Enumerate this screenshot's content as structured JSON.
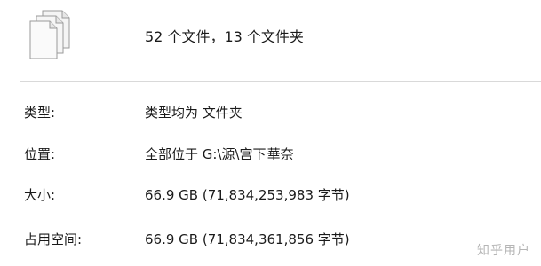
{
  "header": {
    "icon": "multiple-files-icon",
    "summary": "52 个文件，13 个文件夹"
  },
  "properties": [
    {
      "label": "类型:",
      "value": "类型均为 文件夹"
    },
    {
      "label": "位置:",
      "value_before_caret": "全部位于 G:\\源\\宫下",
      "value_after_caret": "華奈"
    },
    {
      "label": "大小:",
      "value": "66.9 GB (71,834,253,983 字节)"
    },
    {
      "label": "占用空间:",
      "value": "66.9 GB (71,834,361,856 字节)"
    }
  ],
  "watermark": "知乎用户"
}
